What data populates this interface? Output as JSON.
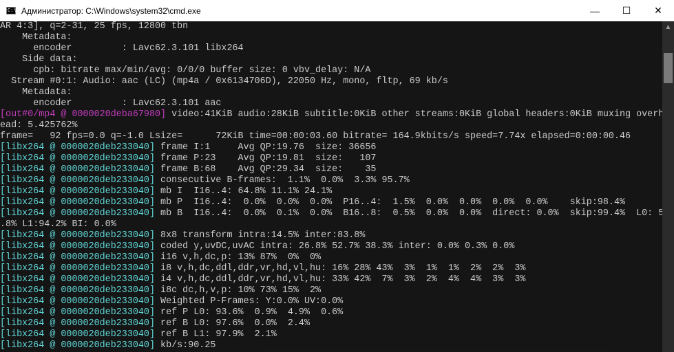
{
  "window": {
    "title": "Администратор: C:\\Windows\\system32\\cmd.exe",
    "icon": "cmd-icon",
    "icon_text": "C:\\_",
    "minimize": "—",
    "maximize": "☐",
    "close": "✕"
  },
  "console": {
    "lines": [
      {
        "prefix": "",
        "color": "",
        "text": "AR 4:3], q=2-31, 25 fps, 12800 tbn"
      },
      {
        "prefix": "",
        "color": "",
        "text": "    Metadata:"
      },
      {
        "prefix": "",
        "color": "",
        "text": "      encoder         : Lavc62.3.101 libx264"
      },
      {
        "prefix": "",
        "color": "",
        "text": "    Side data:"
      },
      {
        "prefix": "",
        "color": "",
        "text": "      cpb: bitrate max/min/avg: 0/0/0 buffer size: 0 vbv_delay: N/A"
      },
      {
        "prefix": "",
        "color": "",
        "text": "  Stream #0:1: Audio: aac (LC) (mp4a / 0x6134706D), 22050 Hz, mono, fltp, 69 kb/s"
      },
      {
        "prefix": "",
        "color": "",
        "text": "    Metadata:"
      },
      {
        "prefix": "",
        "color": "",
        "text": "      encoder         : Lavc62.3.101 aac"
      },
      {
        "prefix": "[out#0/mp4 @ 0000020deba67980]",
        "color": "magenta",
        "text": " video:41KiB audio:28KiB subtitle:0KiB other streams:0KiB global headers:0KiB muxing overh"
      },
      {
        "prefix": "",
        "color": "",
        "text": "ead: 5.425762%"
      },
      {
        "prefix": "",
        "color": "",
        "text": "frame=   92 fps=0.0 q=-1.0 Lsize=      72KiB time=00:00:03.60 bitrate= 164.9kbits/s speed=7.74x elapsed=0:00:00.46"
      },
      {
        "prefix": "[libx264 @ 0000020deb233040]",
        "color": "cyan",
        "text": " frame I:1     Avg QP:19.76  size: 36656"
      },
      {
        "prefix": "[libx264 @ 0000020deb233040]",
        "color": "cyan",
        "text": " frame P:23    Avg QP:19.81  size:   107"
      },
      {
        "prefix": "[libx264 @ 0000020deb233040]",
        "color": "cyan",
        "text": " frame B:68    Avg QP:29.34  size:    35"
      },
      {
        "prefix": "[libx264 @ 0000020deb233040]",
        "color": "cyan",
        "text": " consecutive B-frames:  1.1%  0.0%  3.3% 95.7%"
      },
      {
        "prefix": "[libx264 @ 0000020deb233040]",
        "color": "cyan",
        "text": " mb I  I16..4: 64.8% 11.1% 24.1%"
      },
      {
        "prefix": "[libx264 @ 0000020deb233040]",
        "color": "cyan",
        "text": " mb P  I16..4:  0.0%  0.0%  0.0%  P16..4:  1.5%  0.0%  0.0%  0.0%  0.0%    skip:98.4%"
      },
      {
        "prefix": "[libx264 @ 0000020deb233040]",
        "color": "cyan",
        "text": " mb B  I16..4:  0.0%  0.1%  0.0%  B16..8:  0.5%  0.0%  0.0%  direct: 0.0%  skip:99.4%  L0: 5"
      },
      {
        "prefix": "",
        "color": "",
        "text": ".8% L1:94.2% BI: 0.0%"
      },
      {
        "prefix": "[libx264 @ 0000020deb233040]",
        "color": "cyan",
        "text": " 8x8 transform intra:14.5% inter:83.8%"
      },
      {
        "prefix": "[libx264 @ 0000020deb233040]",
        "color": "cyan",
        "text": " coded y,uvDC,uvAC intra: 26.8% 52.7% 38.3% inter: 0.0% 0.3% 0.0%"
      },
      {
        "prefix": "[libx264 @ 0000020deb233040]",
        "color": "cyan",
        "text": " i16 v,h,dc,p: 13% 87%  0%  0%"
      },
      {
        "prefix": "[libx264 @ 0000020deb233040]",
        "color": "cyan",
        "text": " i8 v,h,dc,ddl,ddr,vr,hd,vl,hu: 16% 28% 43%  3%  1%  1%  2%  2%  3%"
      },
      {
        "prefix": "[libx264 @ 0000020deb233040]",
        "color": "cyan",
        "text": " i4 v,h,dc,ddl,ddr,vr,hd,vl,hu: 33% 42%  7%  3%  2%  4%  4%  3%  3%"
      },
      {
        "prefix": "[libx264 @ 0000020deb233040]",
        "color": "cyan",
        "text": " i8c dc,h,v,p: 10% 73% 15%  2%"
      },
      {
        "prefix": "[libx264 @ 0000020deb233040]",
        "color": "cyan",
        "text": " Weighted P-Frames: Y:0.0% UV:0.0%"
      },
      {
        "prefix": "[libx264 @ 0000020deb233040]",
        "color": "cyan",
        "text": " ref P L0: 93.6%  0.9%  4.9%  0.6%"
      },
      {
        "prefix": "[libx264 @ 0000020deb233040]",
        "color": "cyan",
        "text": " ref B L0: 97.6%  0.0%  2.4%"
      },
      {
        "prefix": "[libx264 @ 0000020deb233040]",
        "color": "cyan",
        "text": " ref B L1: 97.9%  2.1%"
      },
      {
        "prefix": "[libx264 @ 0000020deb233040]",
        "color": "cyan",
        "text": " kb/s:90.25"
      }
    ]
  },
  "scrollbar": {
    "up_arrow": "▲"
  }
}
